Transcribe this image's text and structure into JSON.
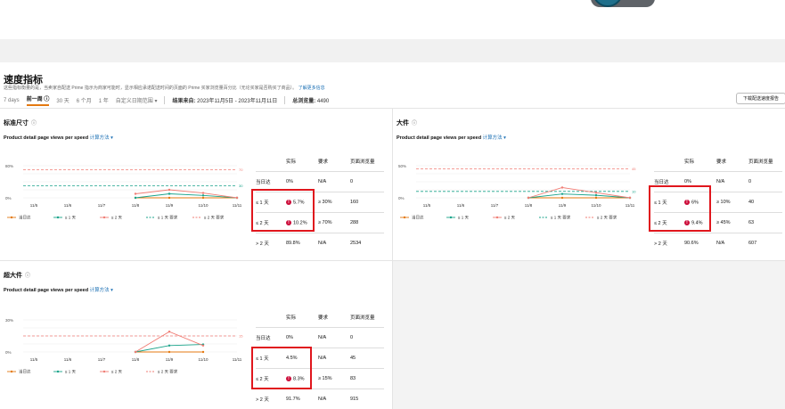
{
  "header": {
    "title": "速度指标",
    "subtitle": "这些指标衡量的是，当卖家自配送 Prime 指示为商家可能时，显示相应承诺配送时间的页面的 Prime 买家浏览量百分比（无论买家是否购买了商品）。",
    "learn_more": "了解更多信息"
  },
  "filters": {
    "options": [
      "7 days",
      "前一周",
      "30 天",
      "6 个月",
      "1 年",
      "自定义日期范围"
    ],
    "active_info_glyph": "ⓘ",
    "dropdown_glyph": "▾",
    "result_source_label": "结果来自:",
    "result_source_value": "2023年11月5日 - 2023年11月11日",
    "total_views_label": "总浏览量:",
    "total_views_value": "4490"
  },
  "download_button": "下载配送速度报告",
  "common": {
    "info_glyph": "ⓘ",
    "views_per_speed": "Product detail page views per speed",
    "calc_method": "计算方法",
    "dropdown_glyph": "▾",
    "table_headers": [
      "",
      "实际",
      "要求",
      "页面浏览量"
    ],
    "warn_glyph": "!"
  },
  "colors": {
    "orange": "#e47911",
    "teal": "#1aa38a",
    "salmon": "#f07c74",
    "red_box": "#e0161d",
    "warn": "#cc0c39"
  },
  "panels": [
    {
      "key": "standard",
      "title": "标准尺寸",
      "table_rows": [
        {
          "label": "当日达",
          "actual": "0%",
          "req": "N/A",
          "views": "0",
          "warn": false
        },
        {
          "label": "≤ 1 天",
          "actual": "5.7%",
          "req": "≥ 30%",
          "views": "160",
          "warn": true
        },
        {
          "label": "≤ 2 天",
          "actual": "10.2%",
          "req": "≥ 70%",
          "views": "288",
          "warn": true
        },
        {
          "label": "> 2 天",
          "actual": "89.8%",
          "req": "N/A",
          "views": "2534",
          "warn": false
        }
      ],
      "chart_data": {
        "type": "line",
        "x": [
          "11/5",
          "11/6",
          "11/7",
          "11/8",
          "11/9",
          "11/10",
          "11/11"
        ],
        "ytick_labels": [
          "0%",
          "80%"
        ],
        "ylim": [
          0,
          80
        ],
        "series": [
          {
            "name": "当日达",
            "color": "#e47911",
            "values": [
              null,
              null,
              null,
              0,
              0,
              0,
              0
            ]
          },
          {
            "name": "≤ 1 天",
            "color": "#1aa38a",
            "values": [
              null,
              null,
              null,
              0,
              10,
              6,
              0
            ]
          },
          {
            "name": "≤ 2 天",
            "color": "#f07c74",
            "values": [
              null,
              null,
              null,
              10,
              20,
              12,
              0
            ]
          }
        ],
        "req_lines": [
          {
            "name": "≤ 1 天 要求",
            "color": "#1aa38a",
            "value": 30,
            "label": "30"
          },
          {
            "name": "≤ 2 天 要求",
            "color": "#f07c74",
            "value": 70,
            "label": "70"
          }
        ],
        "legend": [
          "当日达",
          "≤ 1 天",
          "≤ 2 天",
          "≤ 1 天 要求",
          "≤ 2 天 要求"
        ]
      }
    },
    {
      "key": "large",
      "title": "大件",
      "table_rows": [
        {
          "label": "当日达",
          "actual": "0%",
          "req": "N/A",
          "views": "0",
          "warn": false
        },
        {
          "label": "≤ 1 天",
          "actual": "6%",
          "req": "≥ 10%",
          "views": "40",
          "warn": true
        },
        {
          "label": "≤ 2 天",
          "actual": "9.4%",
          "req": "≥ 45%",
          "views": "63",
          "warn": true
        },
        {
          "label": "> 2 天",
          "actual": "90.6%",
          "req": "N/A",
          "views": "607",
          "warn": false
        }
      ],
      "chart_data": {
        "type": "line",
        "x": [
          "11/5",
          "11/6",
          "11/7",
          "11/8",
          "11/9",
          "11/10",
          "11/11"
        ],
        "ytick_labels": [
          "0%",
          "50%"
        ],
        "ylim": [
          0,
          50
        ],
        "series": [
          {
            "name": "当日达",
            "color": "#e47911",
            "values": [
              null,
              null,
              null,
              0,
              0,
              0,
              0
            ]
          },
          {
            "name": "≤ 1 天",
            "color": "#1aa38a",
            "values": [
              null,
              null,
              null,
              0,
              6,
              4,
              0
            ]
          },
          {
            "name": "≤ 2 天",
            "color": "#f07c74",
            "values": [
              null,
              null,
              null,
              0,
              16,
              8,
              0
            ]
          }
        ],
        "req_lines": [
          {
            "name": "≤ 1 天 要求",
            "color": "#1aa38a",
            "value": 10,
            "label": "10"
          },
          {
            "name": "≤ 2 天 要求",
            "color": "#f07c74",
            "value": 45,
            "label": "45"
          }
        ],
        "legend": [
          "当日达",
          "≤ 1 天",
          "≤ 2 天",
          "≤ 1 天 要求",
          "≤ 2 天 要求"
        ]
      }
    },
    {
      "key": "oversize",
      "title": "超大件",
      "table_rows": [
        {
          "label": "当日达",
          "actual": "0%",
          "req": "N/A",
          "views": "0",
          "warn": false
        },
        {
          "label": "≤ 1 天",
          "actual": "4.5%",
          "req": "N/A",
          "views": "45",
          "warn": false
        },
        {
          "label": "≤ 2 天",
          "actual": "8.3%",
          "req": "≥ 15%",
          "views": "83",
          "warn": true
        },
        {
          "label": "> 2 天",
          "actual": "91.7%",
          "req": "N/A",
          "views": "915",
          "warn": false
        }
      ],
      "chart_data": {
        "type": "line",
        "x": [
          "11/5",
          "11/6",
          "11/7",
          "11/8",
          "11/9",
          "11/10",
          "11/11"
        ],
        "ytick_labels": [
          "0%",
          "30%"
        ],
        "ylim": [
          0,
          30
        ],
        "series": [
          {
            "name": "当日达",
            "color": "#e47911",
            "values": [
              null,
              null,
              null,
              0,
              0,
              0,
              null
            ]
          },
          {
            "name": "≤ 1 天",
            "color": "#1aa38a",
            "values": [
              null,
              null,
              null,
              0,
              6,
              7,
              null
            ]
          },
          {
            "name": "≤ 2 天",
            "color": "#f07c74",
            "values": [
              null,
              null,
              null,
              0,
              19,
              6,
              null
            ]
          }
        ],
        "req_lines": [
          {
            "name": "≤ 2 天 要求",
            "color": "#f07c74",
            "value": 15,
            "label": "15"
          }
        ],
        "legend": [
          "当日达",
          "≤ 1 天",
          "≤ 2 天",
          "≤ 2 天 要求"
        ]
      }
    }
  ]
}
